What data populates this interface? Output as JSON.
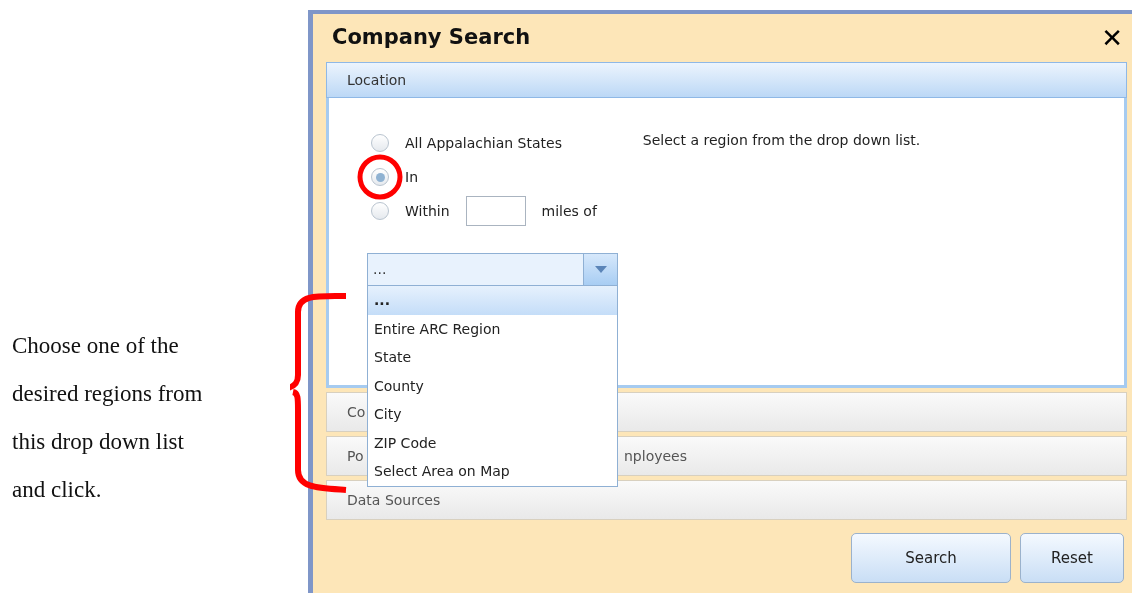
{
  "note": {
    "lines": [
      "Choose one of the",
      "desired regions from",
      "this drop down list",
      "and click."
    ]
  },
  "dialog": {
    "title": "Company Search",
    "close": "✕",
    "location": {
      "header": "Location",
      "expanded": true,
      "hint": "Select a region from the drop down list.",
      "radios": [
        {
          "label": "All Appalachian States",
          "selected": false,
          "kind": "plain"
        },
        {
          "label": "In",
          "selected": true,
          "kind": "plain"
        },
        {
          "label": "Within",
          "selected": false,
          "kind": "miles",
          "suffix": "miles of"
        }
      ],
      "dropdown": {
        "value": "...",
        "expanded": true,
        "options": [
          {
            "label": "...",
            "selected": true
          },
          {
            "label": "Entire ARC Region",
            "selected": false
          },
          {
            "label": "State",
            "selected": false
          },
          {
            "label": "County",
            "selected": false
          },
          {
            "label": "City",
            "selected": false
          },
          {
            "label": "ZIP Code",
            "selected": false
          },
          {
            "label": "Select Area on Map",
            "selected": false
          }
        ]
      }
    },
    "sections": [
      {
        "visible_parts": [
          "Co"
        ]
      },
      {
        "visible_parts": [
          "Po",
          "nployees"
        ]
      },
      {
        "visible_parts": [
          "Data Sources"
        ]
      }
    ],
    "buttons": [
      "Search",
      "Reset"
    ]
  }
}
